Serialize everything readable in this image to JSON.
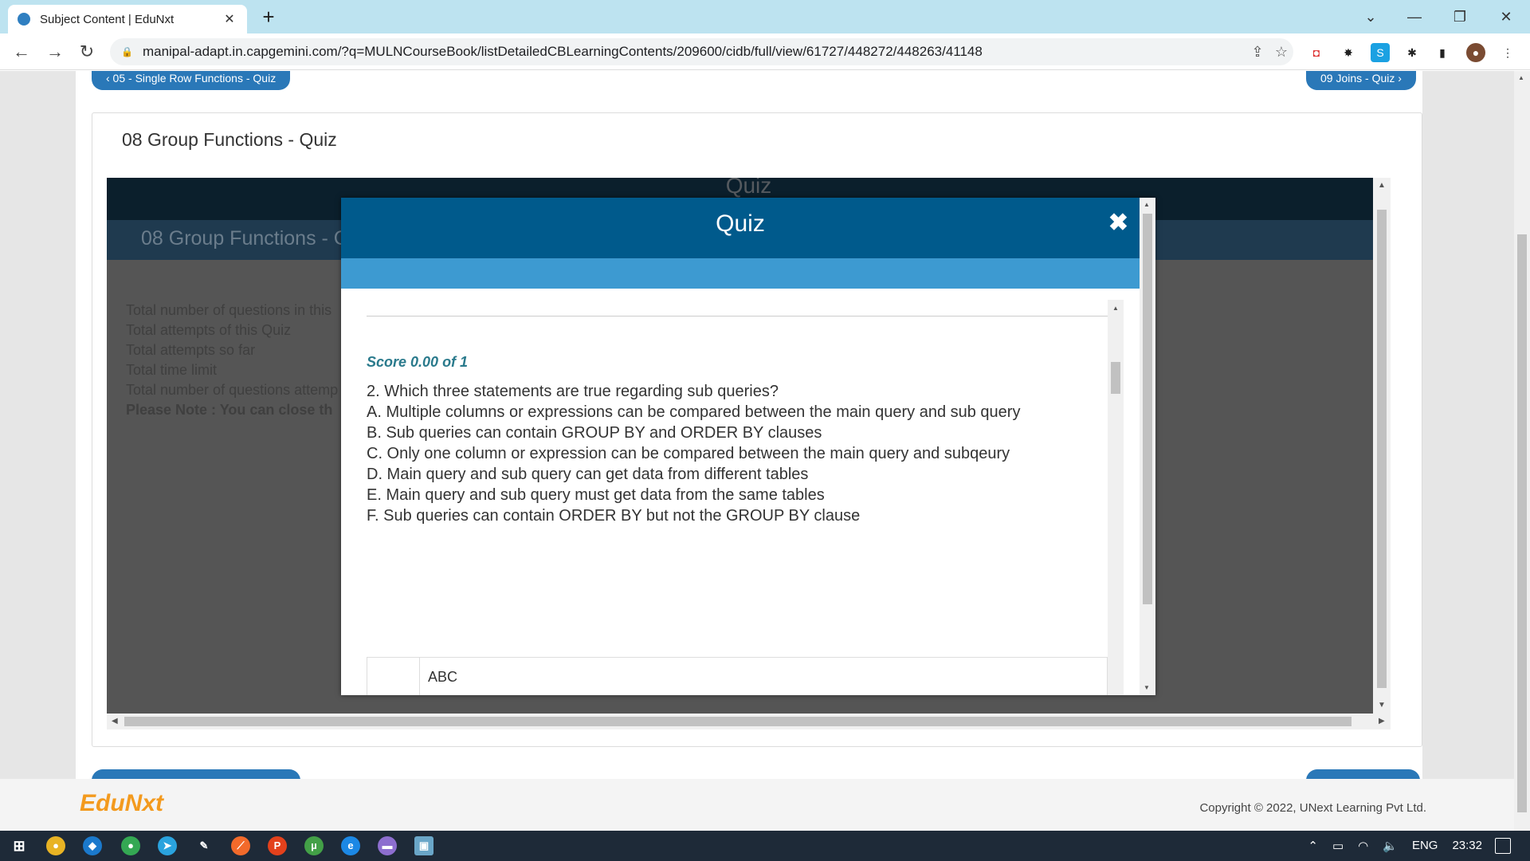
{
  "browser": {
    "tab_title": "Subject Content | EduNxt",
    "tab_close": "✕",
    "new_tab": "+",
    "url": "manipal-adapt.in.capgemini.com/?q=MULNCourseBook/listDetailedCBLearningContents/209600/cidb/full/view/61727/448272/448263/41148"
  },
  "nav": {
    "prev_label": "‹ 05 - Single Row Functions - Quiz",
    "next_label": "09 Joins - Quiz ›"
  },
  "card": {
    "title": "08 Group Functions - Quiz"
  },
  "frame": {
    "header": "Quiz",
    "subheader": "08 Group Functions - C",
    "info_lines": [
      "Total number of questions in this",
      "Total attempts of this Quiz",
      "Total attempts so far",
      "Total time limit",
      "Total number of questions attemp"
    ],
    "note": "Please Note : You can close th"
  },
  "modal": {
    "title": "Quiz",
    "close": "✖",
    "score": "Score 0.00 of 1",
    "question": "2. Which three statements are true regarding sub queries?",
    "options": [
      "A. Multiple columns or expressions can be compared between the main query and sub query",
      "B. Sub queries can contain GROUP BY and ORDER BY clauses",
      "C. Only one column or expression can be compared between the main query and subqeury",
      "D. Main query and sub query can get data from different tables",
      "E. Main query and sub query must get data from the same tables",
      "F. Sub queries can contain ORDER BY but not the GROUP BY clause"
    ],
    "answer": "ABC"
  },
  "footer": {
    "logo": "EduNxt",
    "copyright": "Copyright © 2022, UNext Learning Pvt Ltd."
  },
  "taskbar": {
    "lang": "ENG",
    "time": "23:32"
  }
}
